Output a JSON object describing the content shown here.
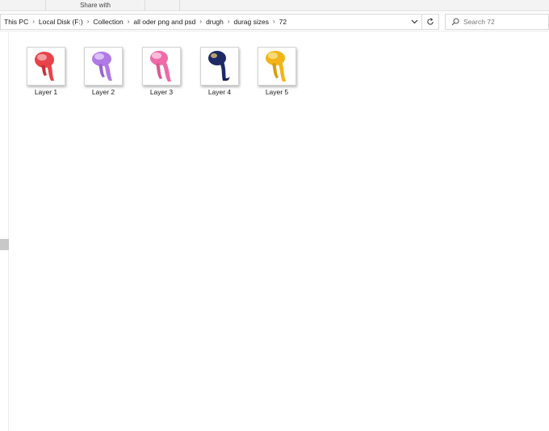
{
  "ribbon": {
    "share_tab": "Share with"
  },
  "address": {
    "crumbs": [
      "This PC",
      "Local Disk (F:)",
      "Collection",
      "all oder png and psd",
      "drugh",
      "durag sizes",
      "72"
    ]
  },
  "search": {
    "placeholder": "Search 72"
  },
  "files": [
    {
      "name": "Layer 1",
      "color": "#e8434a",
      "accent": "#f7b5b8"
    },
    {
      "name": "Layer 2",
      "color": "#b07ae6",
      "accent": "#e2cdf7"
    },
    {
      "name": "Layer 3",
      "color": "#f06aa8",
      "accent": "#fbc7df"
    },
    {
      "name": "Layer 4",
      "color": "#1e2a66",
      "accent": "#c9b06a"
    },
    {
      "name": "Layer 5",
      "color": "#f2b418",
      "accent": "#f9e08a"
    }
  ],
  "icons": {
    "dropdown": "chevron-down-icon",
    "refresh": "refresh-icon",
    "search": "search-icon",
    "separator": "chevron-right-icon"
  }
}
